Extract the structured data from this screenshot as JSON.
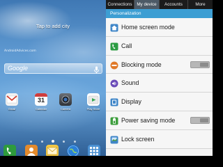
{
  "home": {
    "weather_prompt": "Tap to add city",
    "watermark": "AndroidAdvices.com",
    "search": {
      "label": "Google"
    },
    "apps": [
      {
        "label": "Gmail",
        "icon": "gmail-icon"
      },
      {
        "label": "Calendar",
        "icon": "calendar-icon",
        "badge": "31"
      },
      {
        "label": "Camera",
        "icon": "camera-icon"
      },
      {
        "label": "Play Store",
        "icon": "play-store-icon"
      }
    ],
    "page_count": 5,
    "active_page": 3,
    "dock": [
      {
        "icon": "phone-icon"
      },
      {
        "icon": "contacts-icon"
      },
      {
        "icon": "messaging-icon"
      },
      {
        "icon": "internet-icon"
      },
      {
        "icon": "apps-icon"
      }
    ]
  },
  "settings": {
    "tabs": [
      {
        "label": "Connections",
        "active": false
      },
      {
        "label": "My device",
        "active": true
      },
      {
        "label": "Accounts",
        "active": false
      },
      {
        "label": "More",
        "active": false
      }
    ],
    "section_header": "Personalization",
    "items": [
      {
        "label": "Home screen mode",
        "icon": "home-screen-icon",
        "toggle": false
      },
      {
        "label": "Call",
        "icon": "call-icon",
        "toggle": false
      },
      {
        "label": "Blocking mode",
        "icon": "blocking-icon",
        "toggle": true,
        "toggle_state": "off"
      },
      {
        "label": "Sound",
        "icon": "sound-icon",
        "toggle": false
      },
      {
        "label": "Display",
        "icon": "display-icon",
        "toggle": false
      },
      {
        "label": "Power saving mode",
        "icon": "power-saving-icon",
        "toggle": true,
        "toggle_state": "off"
      },
      {
        "label": "Lock screen",
        "icon": "lock-screen-icon",
        "toggle": false
      }
    ]
  },
  "colors": {
    "section_header": "#3d9ed3",
    "active_tab": "#4d5a66",
    "tab_bar": "#1b1b1b",
    "list_background": "#f6f6f6"
  }
}
